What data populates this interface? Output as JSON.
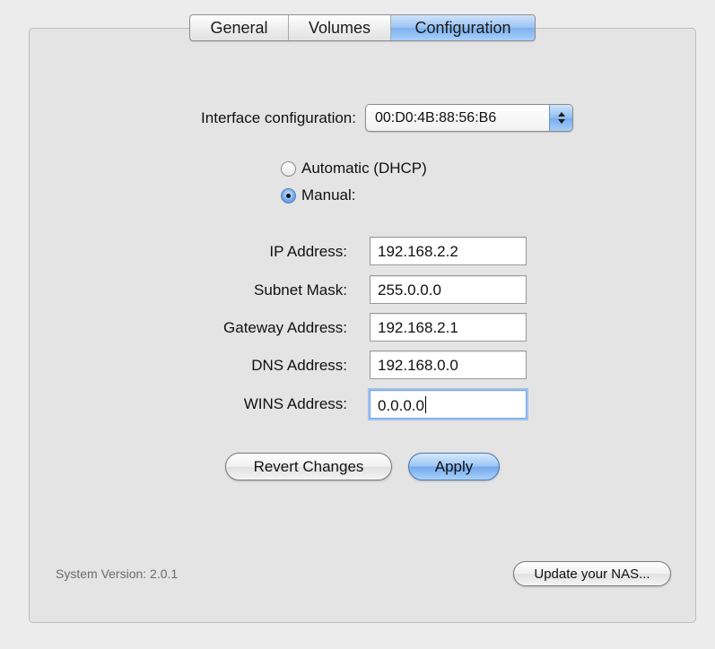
{
  "tabs": [
    {
      "label": "General",
      "selected": false
    },
    {
      "label": "Volumes",
      "selected": false
    },
    {
      "label": "Configuration",
      "selected": true
    }
  ],
  "interface": {
    "label": "Interface configuration:",
    "selected_value": "00:D0:4B:88:56:B6"
  },
  "mode": {
    "automatic_label": "Automatic (DHCP)",
    "manual_label": "Manual:",
    "selected": "manual"
  },
  "fields": {
    "ip_label": "IP Address:",
    "ip_value": "192.168.2.2",
    "mask_label": "Subnet Mask:",
    "mask_value": "255.0.0.0",
    "gateway_label": "Gateway Address:",
    "gateway_value": "192.168.2.1",
    "dns_label": "DNS Address:",
    "dns_value": "192.168.0.0",
    "wins_label": "WINS Address:",
    "wins_value": "0.0.0.0"
  },
  "buttons": {
    "revert_label": "Revert Changes",
    "apply_label": "Apply",
    "update_label": "Update your NAS..."
  },
  "footer": {
    "version_text": "System Version: 2.0.1"
  },
  "colors": {
    "accent": "#7eb2ef",
    "panel_background": "#e4e4e4",
    "window_background": "#ececec"
  }
}
